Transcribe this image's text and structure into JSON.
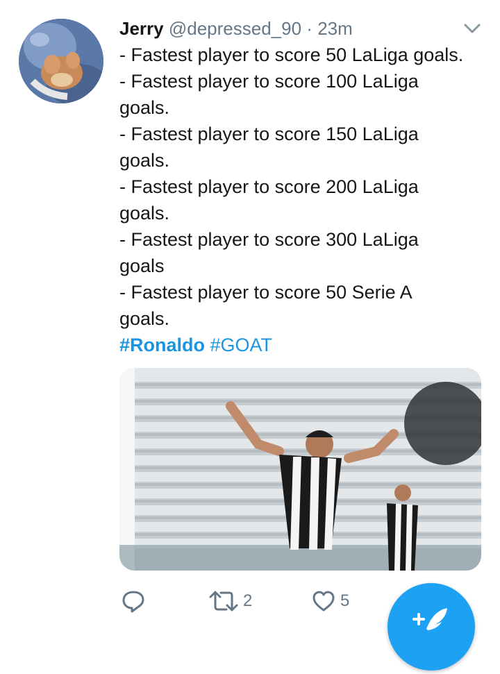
{
  "tweet": {
    "display_name": "Jerry",
    "handle": "@depressed_90",
    "separator": "·",
    "time": "23m",
    "lines": [
      "- Fastest player to score 50 LaLiga goals.",
      "- Fastest player to score 100 LaLiga",
      "goals.",
      "- Fastest player to score 150 LaLiga",
      "goals.",
      "- Fastest player to score 200 LaLiga",
      "goals.",
      "- Fastest player to score 300 LaLiga",
      "goals",
      "- Fastest player to score 50 Serie A",
      "goals."
    ],
    "hashtags": [
      "#Ronaldo",
      "#GOAT"
    ]
  },
  "actions": {
    "retweet_count": "2",
    "like_count": "5"
  },
  "icons": {
    "chevron": "chevron-down-icon",
    "reply": "reply-icon",
    "retweet": "retweet-icon",
    "like": "heart-icon",
    "compose": "compose-tweet-icon"
  },
  "colors": {
    "hashtag": "#1b95e0",
    "accent": "#1da1f2",
    "secondary_text": "#657786"
  }
}
